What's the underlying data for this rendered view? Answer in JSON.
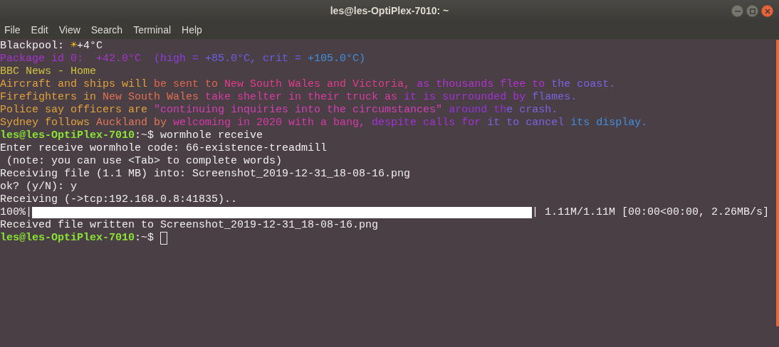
{
  "window": {
    "title": "les@les-OptiPlex-7010: ~"
  },
  "menu": [
    "File",
    "Edit",
    "View",
    "Search",
    "Terminal",
    "Help"
  ],
  "lines": [
    {
      "kind": "text",
      "segments": [
        {
          "text": "Blackpool: ",
          "color": "#eeeeec"
        },
        {
          "text": "☀",
          "color": "#f5c211"
        },
        {
          "text": "+4°C",
          "color": "#eeeeec"
        }
      ]
    },
    {
      "kind": "text",
      "segments": [
        {
          "text": "Package id 0:  +42.0°C  ",
          "color": "#a535cf"
        },
        {
          "text": "(high = ",
          "color": "#8b3ee0"
        },
        {
          "text": "+85.0°C, crit = ",
          "color": "#6c5ee6"
        },
        {
          "text": "+105.0°C)",
          "color": "#3f8ee0"
        }
      ]
    },
    {
      "kind": "text",
      "segments": [
        {
          "text": "BBC News - Home",
          "color": "#cfc23e"
        }
      ]
    },
    {
      "kind": "text",
      "segments": [
        {
          "text": "Aircraft and ships will ",
          "color": "#e0a23a"
        },
        {
          "text": "be sent to ",
          "color": "#e0674f"
        },
        {
          "text": "New South Wales and Victoria, ",
          "color": "#e03c8c"
        },
        {
          "text": "as thousands flee to ",
          "color": "#b232d2"
        },
        {
          "text": "the coast.",
          "color": "#7a62e2"
        }
      ]
    },
    {
      "kind": "text",
      "segments": [
        {
          "text": "Firefighters in ",
          "color": "#e0a23a"
        },
        {
          "text": "New South Wales ",
          "color": "#e07052"
        },
        {
          "text": "take shelter in their truck as ",
          "color": "#d83ca2"
        },
        {
          "text": "it is surrounded by ",
          "color": "#a232d8"
        },
        {
          "text": "flames.",
          "color": "#7a62e2"
        }
      ]
    },
    {
      "kind": "text",
      "segments": [
        {
          "text": "Police say officers are ",
          "color": "#e0a23a"
        },
        {
          "text": "\"continuing inquiries into the circumstances\" ",
          "color": "#d040b4"
        },
        {
          "text": "around th",
          "color": "#9232d8"
        },
        {
          "text": "e crash.",
          "color": "#7a62e2"
        }
      ]
    },
    {
      "kind": "text",
      "segments": [
        {
          "text": "Sydney follows ",
          "color": "#e0a23a"
        },
        {
          "text": "Auckland by ",
          "color": "#e07858"
        },
        {
          "text": "welcoming in 2020 with a bang, ",
          "color": "#d838a8"
        },
        {
          "text": "despite calls for ",
          "color": "#a232d8"
        },
        {
          "text": "it to cancel ",
          "color": "#7a62e2"
        },
        {
          "text": "its display.",
          "color": "#3f8ee0"
        }
      ]
    },
    {
      "kind": "prompt",
      "user": "les@les-OptiPlex-7010",
      "path": ":~$ ",
      "command": "wormhole receive"
    },
    {
      "kind": "text",
      "segments": [
        {
          "text": "Enter receive wormhole code: 66-existence-treadmill",
          "color": "#eeeeec"
        }
      ]
    },
    {
      "kind": "text",
      "segments": [
        {
          "text": " (note: you can use <Tab> to complete words)",
          "color": "#eeeeec"
        }
      ]
    },
    {
      "kind": "text",
      "segments": [
        {
          "text": "Receiving file (1.1 MB) into: Screenshot_2019-12-31_18-08-16.png",
          "color": "#eeeeec"
        }
      ]
    },
    {
      "kind": "text",
      "segments": [
        {
          "text": "ok? (y/N): y",
          "color": "#eeeeec"
        }
      ]
    },
    {
      "kind": "text",
      "segments": [
        {
          "text": "Receiving (->tcp:192.168.0.8:41835)..",
          "color": "#eeeeec"
        }
      ]
    },
    {
      "kind": "progress",
      "percent": "100%|",
      "stats": "| 1.11M/1.11M [00:00<00:00, 2.26MB/s]"
    },
    {
      "kind": "text",
      "segments": [
        {
          "text": "Received file written to Screenshot_2019-12-31_18-08-16.png",
          "color": "#eeeeec"
        }
      ]
    },
    {
      "kind": "prompt",
      "user": "les@les-OptiPlex-7010",
      "path": ":~$ ",
      "cursor": true
    }
  ]
}
